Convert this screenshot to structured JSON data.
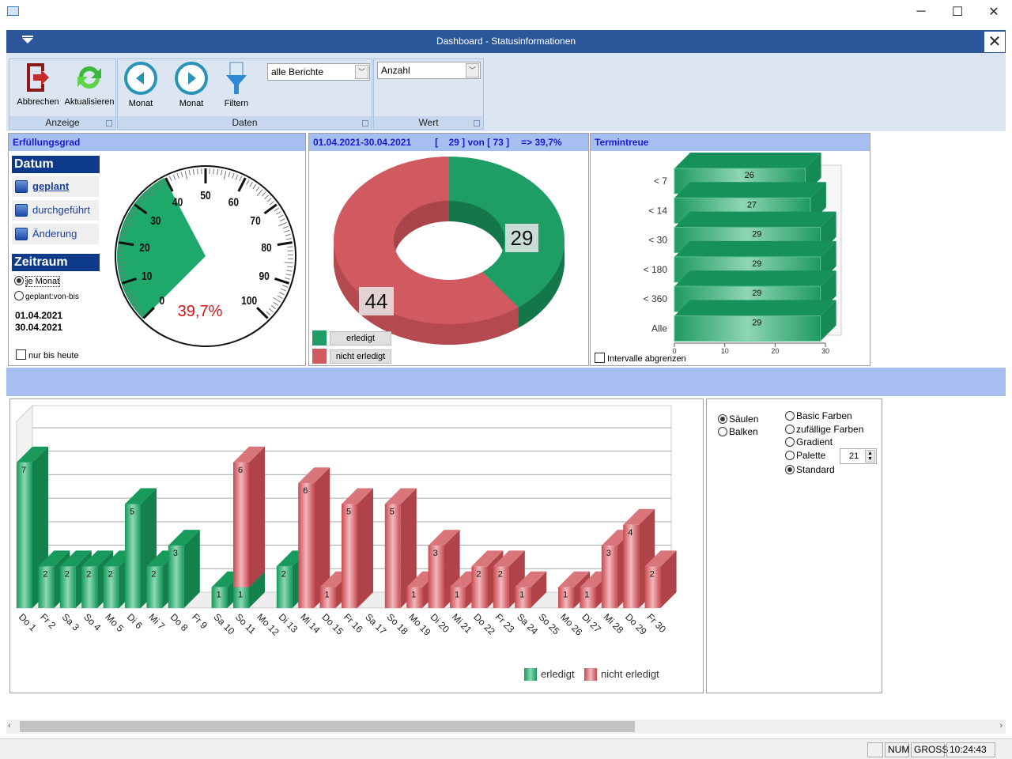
{
  "window": {
    "minimize": "─",
    "maximize": "☐",
    "close": "✕"
  },
  "dashboard": {
    "title": "Dashboard - Statusinformationen",
    "close": "✕"
  },
  "ribbon": {
    "groups": {
      "anzeige": "Anzeige",
      "daten": "Daten",
      "wert": "Wert"
    },
    "buttons": {
      "abbrechen": "Abbrechen",
      "aktualisieren": "Aktualisieren",
      "monat_back": "Monat",
      "monat_fwd": "Monat",
      "filtern": "Filtern"
    },
    "report_select": "alle Berichte",
    "value_select": "Anzahl"
  },
  "fulfillment": {
    "header": "Erfüllungsgrad",
    "datum_title": "Datum",
    "datum_items": [
      "geplant",
      "durchgeführt",
      "Änderung"
    ],
    "zeitraum_title": "Zeitraum",
    "radio_je_monat": "je Monat",
    "radio_geplant": "geplant:von-bis",
    "date_from": "01.04.2021",
    "date_to": "30.04.2021",
    "only_today": "nur bis heute",
    "gauge_value": 39.7,
    "gauge_label": "39,7%",
    "gauge_ticks": [
      "0",
      "10",
      "20",
      "30",
      "40",
      "50",
      "60",
      "70",
      "80",
      "90",
      "100"
    ]
  },
  "donut": {
    "header_range": "01.04.2021-30.04.2021",
    "header_count": "[    29 ] von [ 73 ]",
    "header_pct": "=> 39,7%",
    "done": 29,
    "open": 44,
    "done_label": "29",
    "open_label": "44",
    "legend_done": "erledigt",
    "legend_open": "nicht erledigt",
    "color_done": "#1e9e64",
    "color_open": "#d05a5f"
  },
  "termintreue": {
    "header": "Termintreue",
    "categories": [
      "< 7",
      "< 14",
      "< 30",
      "< 180",
      "< 360",
      "Alle"
    ],
    "values": [
      26,
      27,
      29,
      29,
      29,
      29
    ],
    "xticks": [
      "0",
      "10",
      "20",
      "30"
    ],
    "checkbox": "Intervalle abgrenzen"
  },
  "chart_data": {
    "type": "bar",
    "stacked": true,
    "categories": [
      "Do 1",
      "Fr 2",
      "Sa 3",
      "So 4",
      "Mo 5",
      "Di 6",
      "Mi 7",
      "Do 8",
      "Fr 9",
      "Sa 10",
      "So 11",
      "Mo 12",
      "Di 13",
      "Mi 14",
      "Do 15",
      "Fr 16",
      "Sa 17",
      "So 18",
      "Mo 19",
      "Di 20",
      "Mi 21",
      "Do 22",
      "Fr 23",
      "Sa 24",
      "So 25",
      "Mo 26",
      "Di 27",
      "Mi 28",
      "Do 29",
      "Fr 30"
    ],
    "series": [
      {
        "name": "erledigt",
        "color": "#1e9e64",
        "values": [
          7,
          2,
          2,
          2,
          2,
          5,
          2,
          3,
          0,
          1,
          1,
          0,
          2,
          0,
          0,
          0,
          0,
          0,
          0,
          0,
          0,
          0,
          0,
          0,
          0,
          0,
          0,
          0,
          0,
          0
        ]
      },
      {
        "name": "nicht erledigt",
        "color": "#d05a5f",
        "values": [
          0,
          0,
          0,
          0,
          0,
          0,
          0,
          0,
          0,
          0,
          6,
          0,
          0,
          6,
          1,
          5,
          0,
          5,
          1,
          3,
          1,
          2,
          2,
          1,
          0,
          1,
          1,
          3,
          4,
          2
        ]
      }
    ],
    "ylim": [
      0,
      8
    ],
    "legend": "bottom-right"
  },
  "chart_options": {
    "type_options": [
      "Säulen",
      "Balken"
    ],
    "type_selected": 0,
    "color_options": [
      "Basic Farben",
      "zufällige Farben",
      "Gradient",
      "Palette",
      "Standard"
    ],
    "color_selected": 4,
    "palette_value": "21"
  },
  "statusbar": {
    "num": "NUM",
    "caps": "GROSS",
    "time": "10:24:43"
  }
}
